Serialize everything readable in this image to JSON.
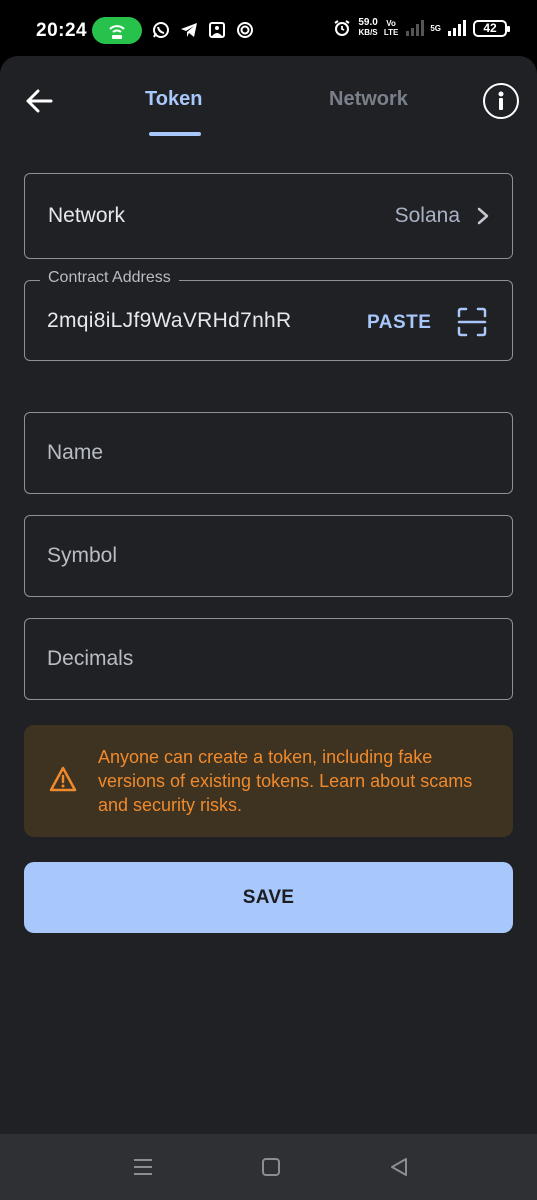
{
  "status_bar": {
    "time": "20:24",
    "speed_value": "59.0",
    "speed_unit": "KB/S",
    "volte_top": "Vo",
    "volte_bottom": "LTE",
    "network_type": "5G",
    "battery": "42",
    "icons": [
      "hotspot-icon",
      "whatsapp-icon",
      "telegram-icon",
      "gallery-icon",
      "app-icon",
      "alarm-icon",
      "signal-icon",
      "battery-icon"
    ]
  },
  "header": {
    "tabs": [
      {
        "label": "Token",
        "active": true
      },
      {
        "label": "Network",
        "active": false
      }
    ]
  },
  "form": {
    "network_label": "Network",
    "network_value": "Solana",
    "contract_legend": "Contract Address",
    "contract_value": "2mqi8iLJf9WaVRHd7nhR",
    "paste_label": "PASTE",
    "name_placeholder": "Name",
    "symbol_placeholder": "Symbol",
    "decimals_placeholder": "Decimals"
  },
  "warning": {
    "text": "Anyone can create a token, including fake versions of existing tokens. Learn about scams and security risks."
  },
  "save_label": "SAVE",
  "colors": {
    "accent": "#a8c7fa",
    "warning_text": "#f08a2c",
    "warning_bg": "#3e3221",
    "surface": "#202124"
  }
}
